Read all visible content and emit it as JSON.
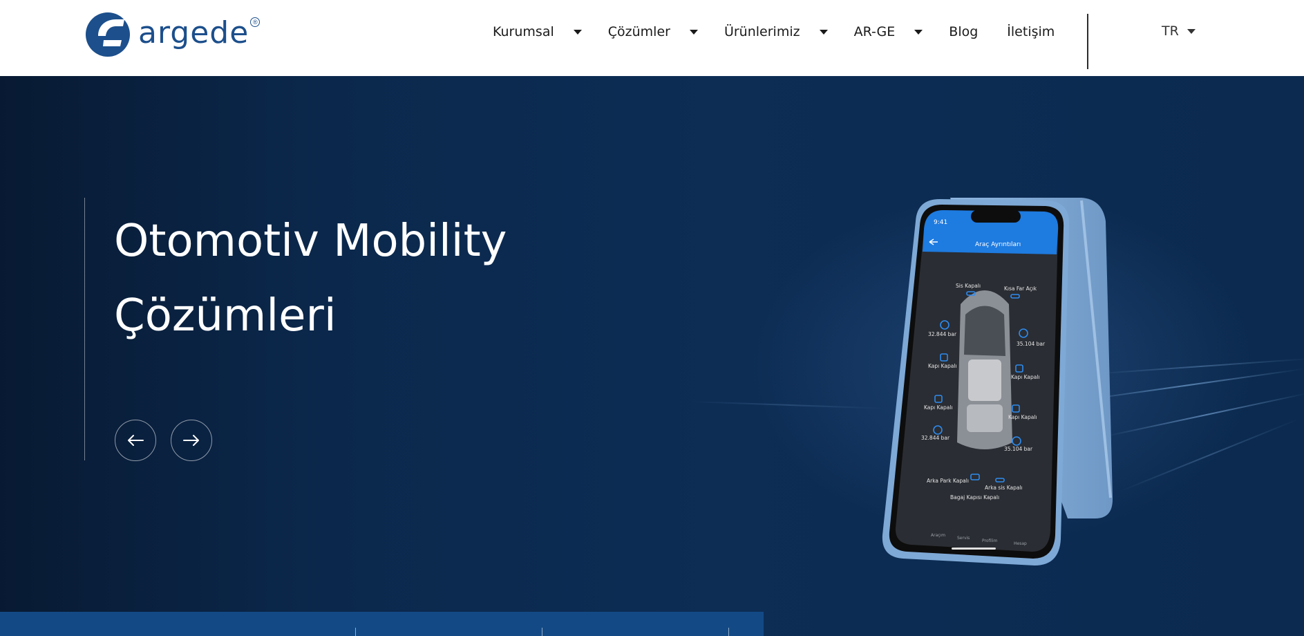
{
  "header": {
    "logo_text": "argede",
    "logo_mark": "argede-logo-icon",
    "nav": [
      {
        "label": "Kurumsal",
        "has_dropdown": true
      },
      {
        "label": "Çözümler",
        "has_dropdown": true
      },
      {
        "label": "Ürünlerimiz",
        "has_dropdown": true
      },
      {
        "label": "AR-GE",
        "has_dropdown": true
      },
      {
        "label": "Blog",
        "has_dropdown": false
      },
      {
        "label": "İletişim",
        "has_dropdown": false
      }
    ],
    "language": "TR"
  },
  "hero": {
    "title_line1": "Otomotiv Mobility",
    "title_line2": "Çözümleri",
    "prev_icon": "arrow-left-icon",
    "next_icon": "arrow-right-icon"
  },
  "phone_screen": {
    "time": "9:41",
    "title": "Araç Ayrıntıları",
    "labels": {
      "fog_front": "Sis Kapalı",
      "short_light": "Kısa Far Açık",
      "tire_fl": "32.844 bar",
      "tire_fr": "35.104 bar",
      "door_fl": "Kapı Kapalı",
      "door_fr": "Kapı Kapalı",
      "door_rl": "Kapı Kapalı",
      "door_rr": "Kapı Kapalı",
      "tire_rl": "32.844 bar",
      "tire_rr": "35.104 bar",
      "rear_park": "Arka Park Kapalı",
      "rear_fog": "Arka sis Kapalı",
      "trunk": "Bagaj Kapısı Kapalı"
    },
    "tabs": [
      "Araçım",
      "Servis",
      "Profilim",
      "Hesap"
    ]
  },
  "colors": {
    "brand": "#1c4f8c",
    "hero_bg": "#0c2a4f",
    "app_blue": "#1e7be0",
    "bottom_bar": "#134a86"
  }
}
